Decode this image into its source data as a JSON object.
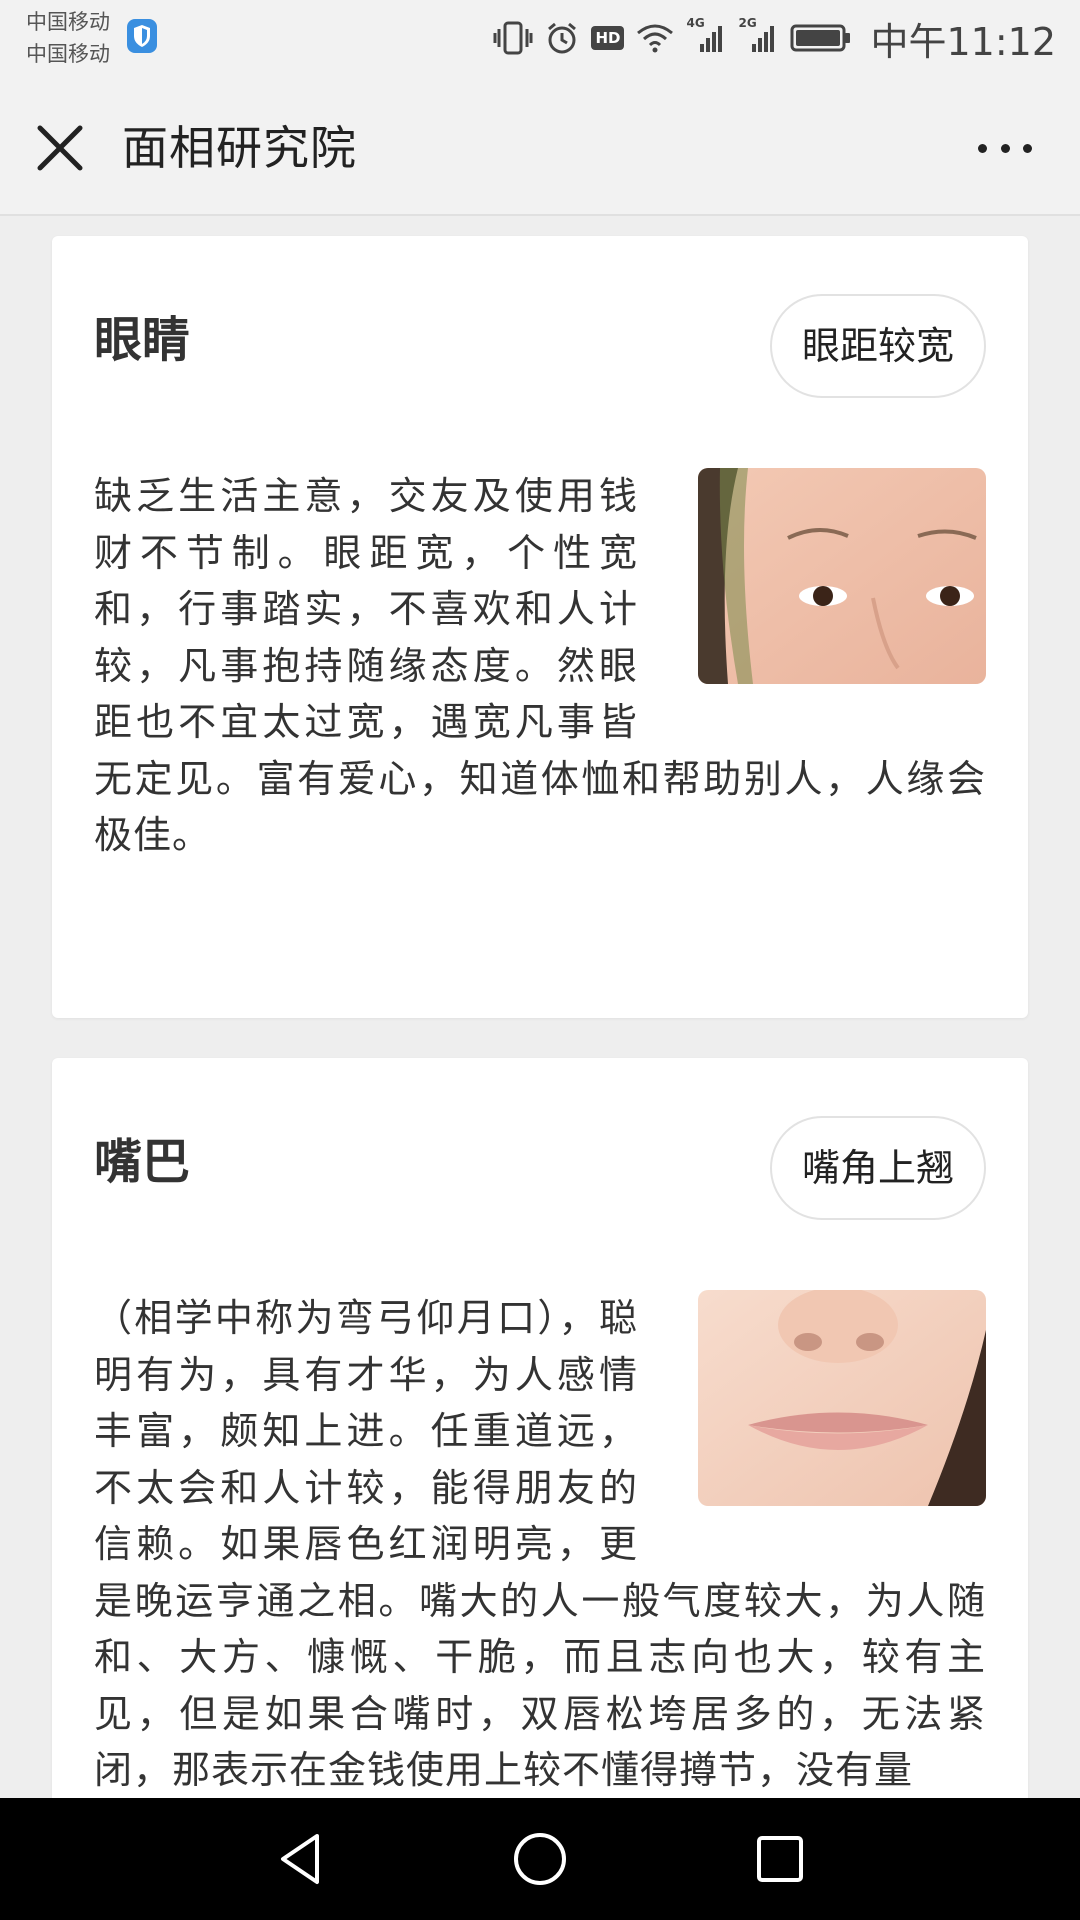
{
  "status": {
    "carrier_1": "中国移动",
    "carrier_2": "中国移动",
    "net_4g": "4G",
    "net_2g": "2G",
    "hd": "HD",
    "time": "中午11:12"
  },
  "header": {
    "title": "面相研究院"
  },
  "cards": [
    {
      "title": "眼睛",
      "tag": "眼距较宽",
      "text": "缺乏生活主意，交友及使用钱财不节制。眼距宽，个性宽和，行事踏实，不喜欢和人计较，凡事抱持随缘态度。然眼距也不宜太过宽，遇宽凡事皆无定见。富有爱心，知道体恤和帮助别人，人缘会极佳。"
    },
    {
      "title": "嘴巴",
      "tag": "嘴角上翘",
      "text": "（相学中称为弯弓仰月口），聪明有为，具有才华，为人感情丰富，颇知上进。任重道远，不太会和人计较，能得朋友的信赖。如果唇色红润明亮，更是晚运亨通之相。嘴大的人一般气度较大，为人随和、大方、慷慨、干脆，而且志向也大，较有主见，但是如果合嘴时，双唇松垮居多的，无法紧闭，那表示在金钱使用上较不懂得撙节，没有量"
    }
  ],
  "colors": {
    "page_bg": "#eeeeee",
    "card_bg": "#ffffff",
    "nav_bg": "#000000"
  }
}
